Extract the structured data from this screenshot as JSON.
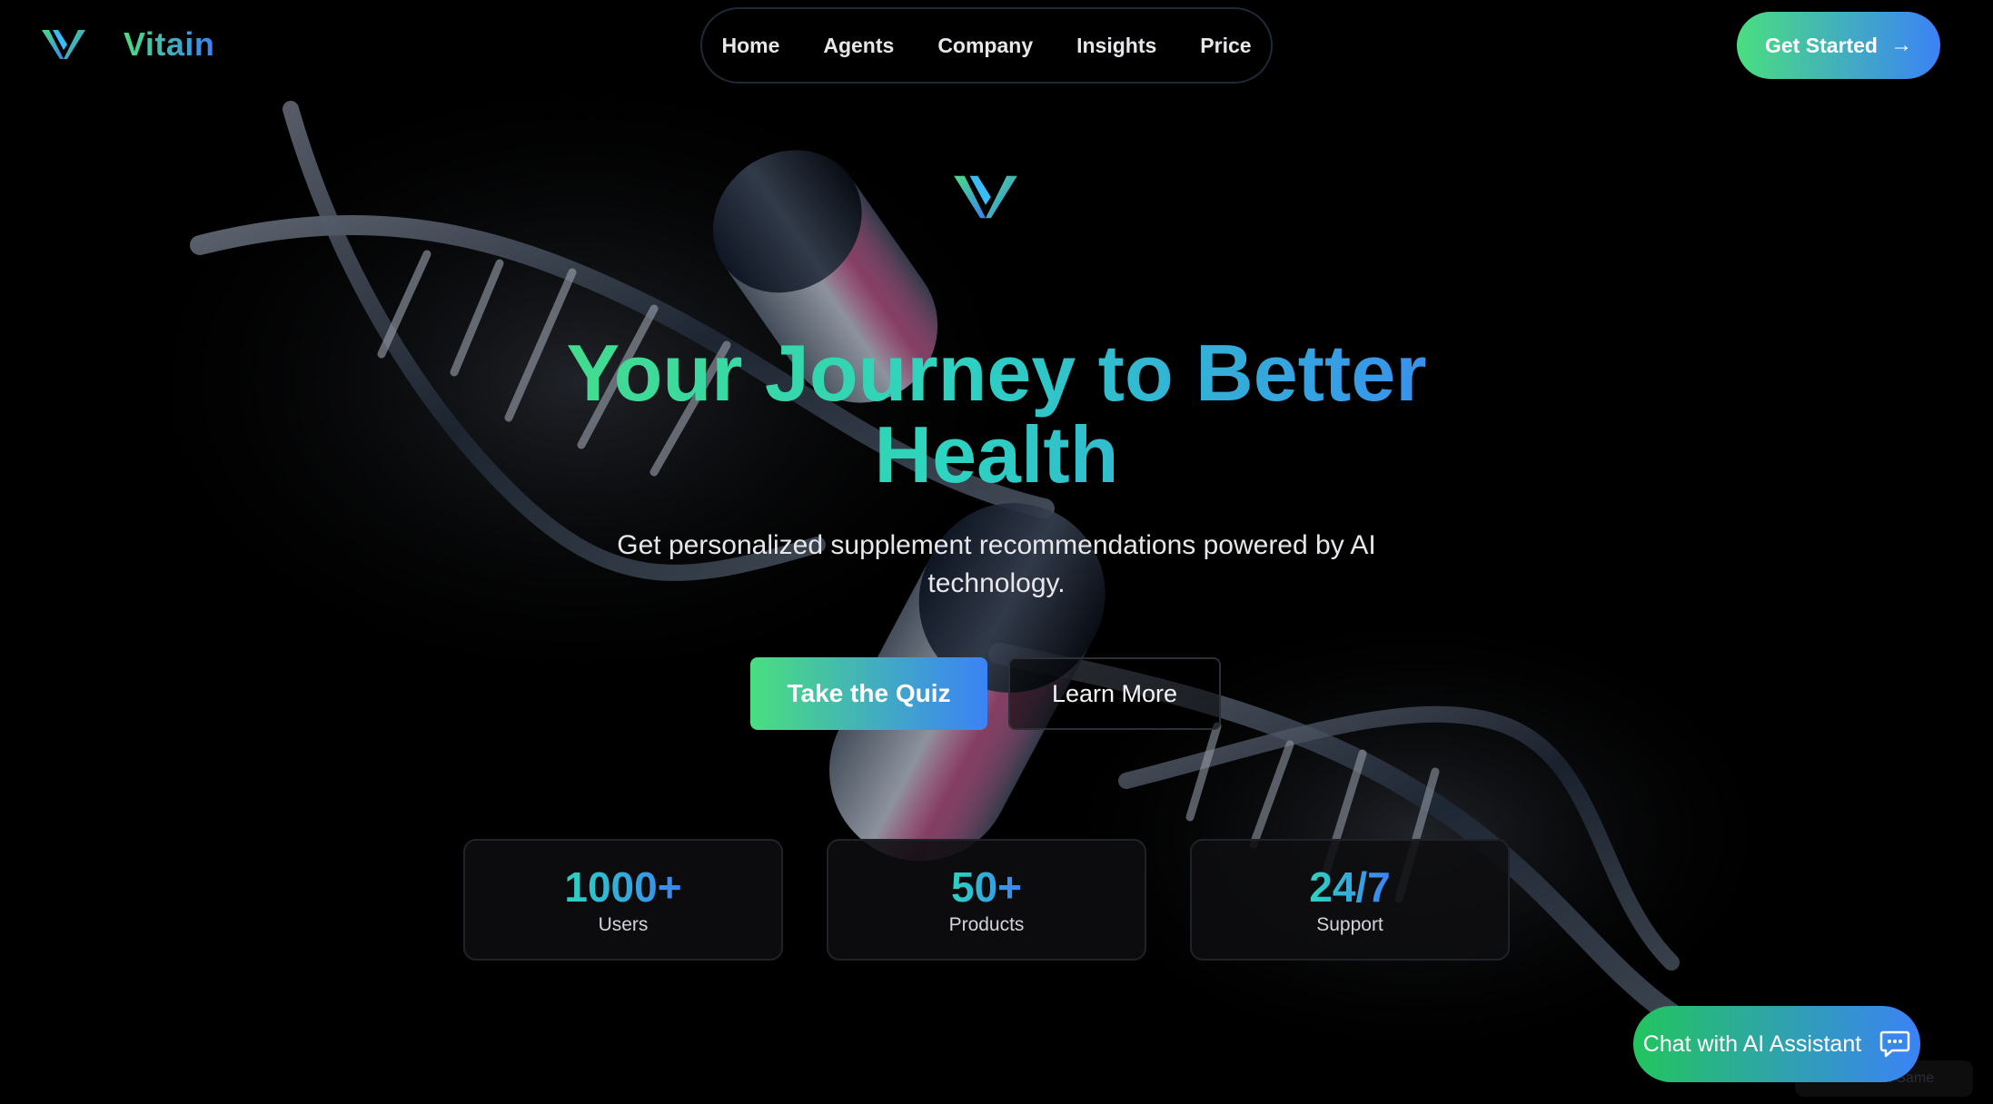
{
  "brand": {
    "name": "Vitain",
    "logo_icon": "vitain-v-logo-icon"
  },
  "nav": {
    "items": [
      "Home",
      "Agents",
      "Company",
      "Insights",
      "Price"
    ]
  },
  "header": {
    "cta_label": "Get Started",
    "cta_icon": "arrow-right-icon",
    "cta_arrow": "→"
  },
  "hero": {
    "title": "Your Journey to Better Health",
    "subtitle": "Get personalized supplement recommendations powered by AI technology.",
    "primary_button": "Take the Quiz",
    "secondary_button": "Learn More"
  },
  "stats": [
    {
      "value": "1000+",
      "label": "Users"
    },
    {
      "value": "50+",
      "label": "Products"
    },
    {
      "value": "24/7",
      "label": "Support"
    }
  ],
  "chat": {
    "label": "Chat with AI Assistant",
    "icon": "chat-bubble-icon"
  },
  "watermark": "Built with Same",
  "colors": {
    "background": "#000000",
    "gradient_start": "#4ade80",
    "gradient_end": "#3b82f6",
    "text_primary": "#ffffff",
    "text_muted": "#d1d5db"
  }
}
